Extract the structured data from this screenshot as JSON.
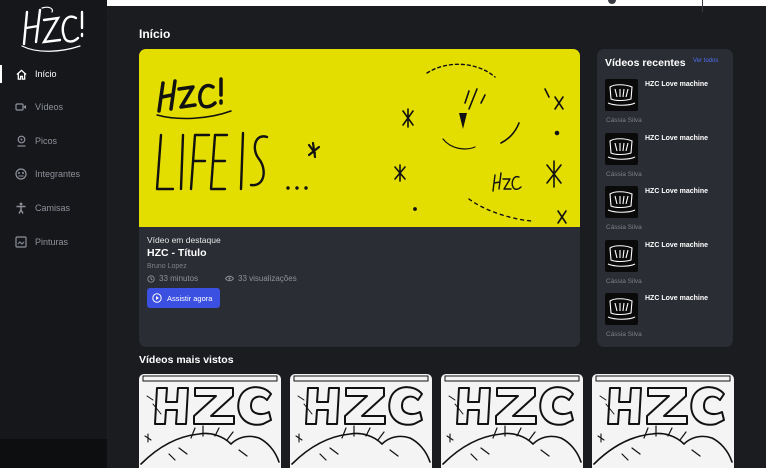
{
  "brand": {
    "logo_text": "HZC"
  },
  "sidebar": {
    "items": [
      {
        "label": "Início",
        "icon": "home-icon",
        "active": true
      },
      {
        "label": "Vídeos",
        "icon": "video-icon",
        "active": false
      },
      {
        "label": "Picos",
        "icon": "map-pin-icon",
        "active": false
      },
      {
        "label": "Integrantes",
        "icon": "group-icon",
        "active": false
      },
      {
        "label": "Camisas",
        "icon": "person-icon",
        "active": false
      },
      {
        "label": "Pinturas",
        "icon": "image-icon",
        "active": false
      }
    ]
  },
  "page": {
    "title": "Início"
  },
  "featured": {
    "label": "Vídeo em destaque",
    "title": "HZC - Título",
    "author": "Bruno Lopez",
    "duration": "33 minutos",
    "views": "33 visualizações",
    "watch_label": "Assistir agora",
    "image_text": "LIFE IS ..."
  },
  "recent": {
    "title": "Vídeos recentes",
    "see_all": "Ver todos",
    "items": [
      {
        "title": "HZC Love machine",
        "author": "Cássia Silva"
      },
      {
        "title": "HZC Love machine",
        "author": "Cássia Silva"
      },
      {
        "title": "HZC Love machine",
        "author": "Cássia Silva"
      },
      {
        "title": "HZC Love machine",
        "author": "Cássia Silva"
      },
      {
        "title": "HZC Love machine",
        "author": "Cássia Silva"
      }
    ]
  },
  "most_viewed": {
    "title": "Vídeos mais vistos",
    "cards": [
      {
        "art_text": "HZC"
      },
      {
        "art_text": "HZC"
      },
      {
        "art_text": "HZC"
      },
      {
        "art_text": "HZC"
      }
    ]
  },
  "colors": {
    "accent": "#3b4fe0",
    "featured_bg": "#e4de00",
    "link": "#4f6ff0"
  }
}
